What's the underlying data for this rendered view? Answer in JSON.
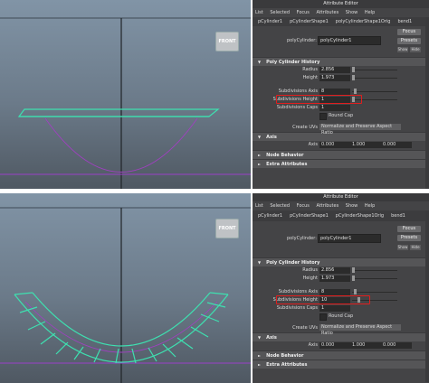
{
  "top": {
    "view_button": "FRONT",
    "editor": {
      "title": "Attribute Editor",
      "menu": [
        "List",
        "Selected",
        "Focus",
        "Attributes",
        "Show",
        "Help"
      ],
      "tabs": [
        "pCylinder1",
        "pCylinderShape1",
        "polyCylinderShape1Orig",
        "bend1"
      ],
      "node_label": "polyCylinder:",
      "node_value": "polyCylinder1",
      "buttons": {
        "focus": "Focus",
        "presets": "Presets",
        "show": "Show",
        "hide": "Hide"
      },
      "section_history": "Poly Cylinder History",
      "radius_label": "Radius",
      "radius_value": "2.856",
      "height_label": "Height",
      "height_value": "1.973",
      "subdiv_axis_label": "Subdivisions Axis",
      "subdiv_axis_value": "8",
      "subdiv_height_label": "Subdivisions Height",
      "subdiv_height_value": "1",
      "subdiv_caps_label": "Subdivisions Caps",
      "subdiv_caps_value": "1",
      "round_cap_label": "Round Cap",
      "create_uvs_label": "Create UVs",
      "create_uvs_value": "Normalize and Preserve Aspect Ratio",
      "section_axis": "Axis",
      "axis_label": "Axis",
      "axis_values": [
        "0.000",
        "1.000",
        "0.000"
      ],
      "section_node": "Node Behavior",
      "section_extra": "Extra Attributes"
    }
  },
  "bottom": {
    "view_button": "FRONT",
    "editor": {
      "title": "Attribute Editor",
      "menu": [
        "List",
        "Selected",
        "Focus",
        "Attributes",
        "Show",
        "Help"
      ],
      "tabs": [
        "pCylinder1",
        "pCylinderShape1",
        "pCylinderShape1Orig",
        "bend1"
      ],
      "node_label": "polyCylinder:",
      "node_value": "polyCylinder1",
      "buttons": {
        "focus": "Focus",
        "presets": "Presets",
        "show": "Show",
        "hide": "Hide"
      },
      "section_history": "Poly Cylinder History",
      "radius_label": "Radius",
      "radius_value": "2.856",
      "height_label": "Height",
      "height_value": "1.973",
      "subdiv_axis_label": "Subdivisions Axis",
      "subdiv_axis_value": "8",
      "subdiv_height_label": "Subdivisions Height",
      "subdiv_height_value": "10",
      "subdiv_caps_label": "Subdivisions Caps",
      "subdiv_caps_value": "1",
      "round_cap_label": "Round Cap",
      "create_uvs_label": "Create UVs",
      "create_uvs_value": "Normalize and Preserve Aspect Ratio",
      "section_axis": "Axis",
      "axis_label": "Axis",
      "axis_values": [
        "0.000",
        "1.000",
        "0.000"
      ],
      "section_node": "Node Behavior",
      "section_extra": "Extra Attributes"
    }
  },
  "colors": {
    "highlight": "#e01e1e",
    "mesh": "#3ee0b0",
    "curve": "#a040c0"
  }
}
